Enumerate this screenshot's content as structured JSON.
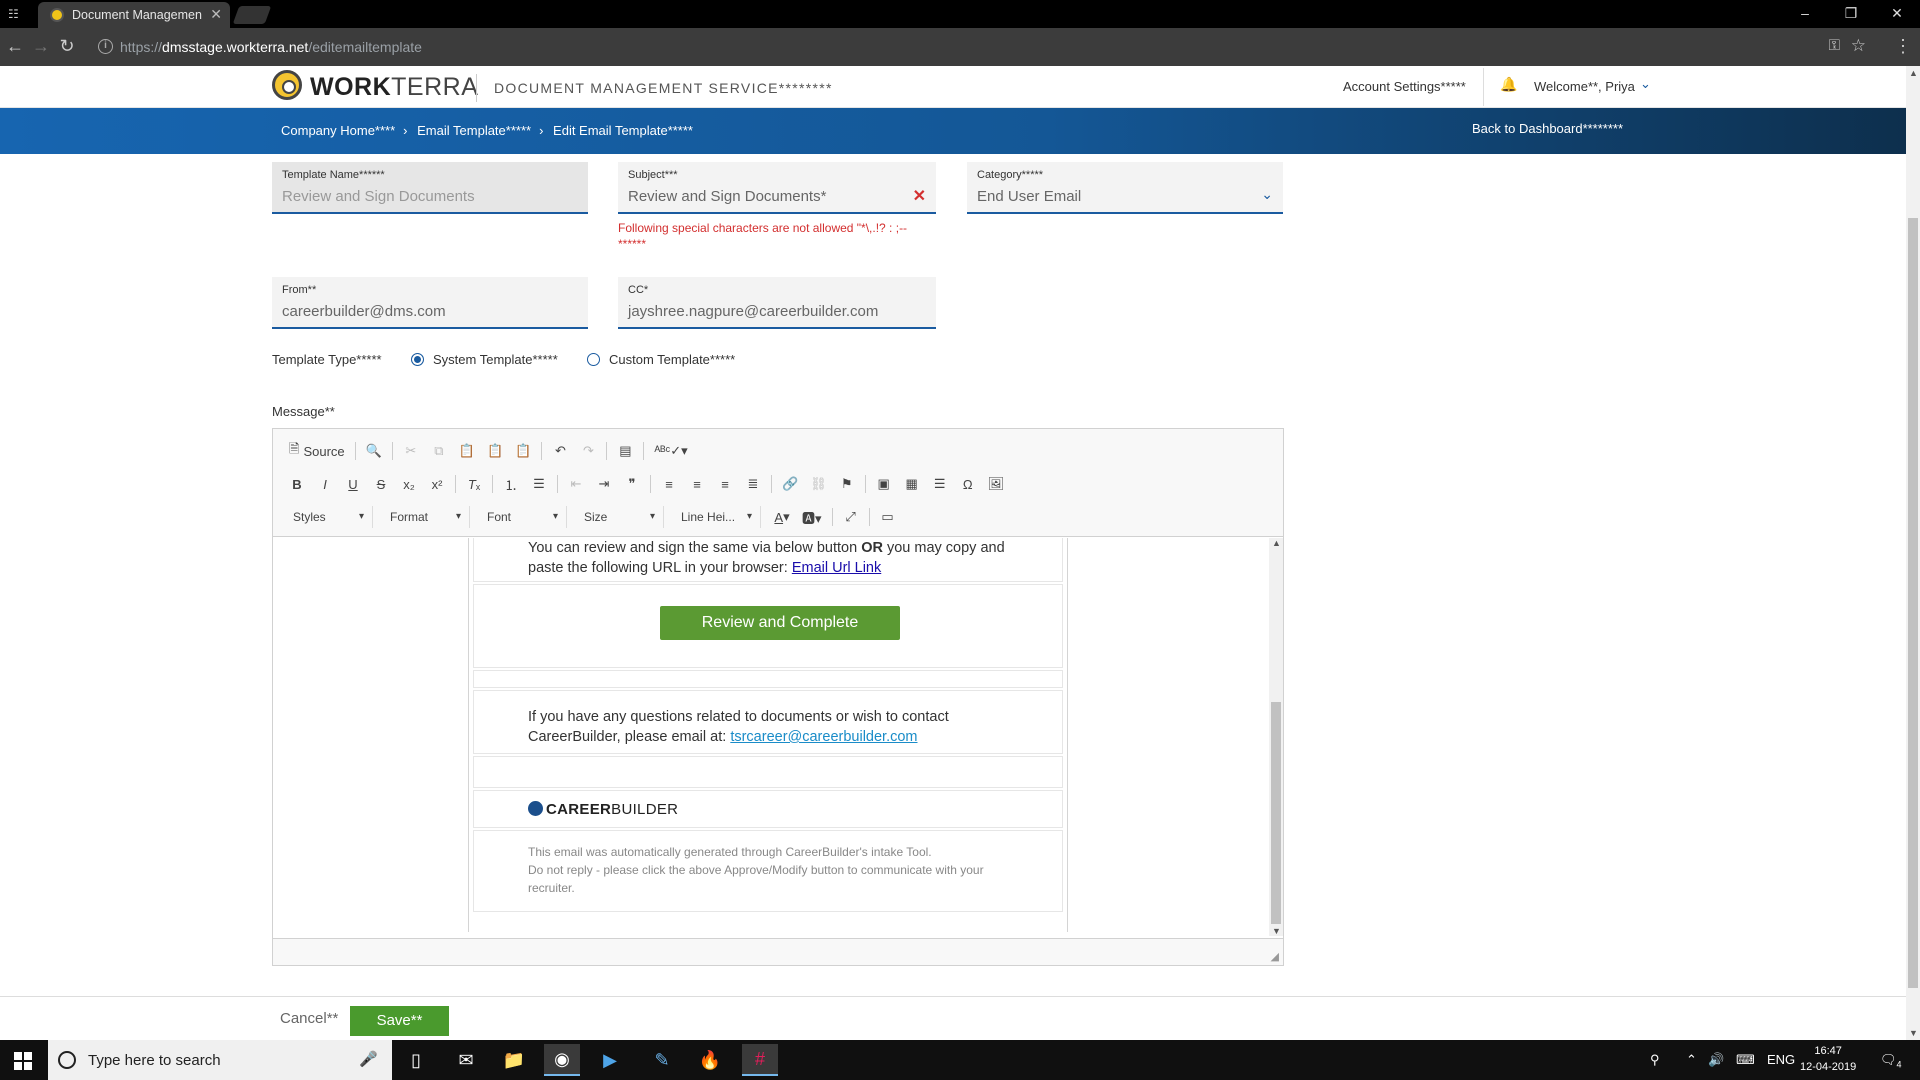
{
  "browser": {
    "tab_title": "Document Management",
    "url_prefix": "https://",
    "url_domain": "dmsstage.workterra.net",
    "url_path": "/editemailtemplate"
  },
  "header": {
    "brand_bold": "WORK",
    "brand_light": "TERRA",
    "app_name": "DOCUMENT MANAGEMENT SERVICE********",
    "account_settings": "Account Settings*****",
    "welcome": "Welcome**, Priya"
  },
  "breadcrumb": {
    "items": [
      "Company Home****",
      "Email Template*****",
      "Edit Email Template*****"
    ],
    "back": "Back to Dashboard********"
  },
  "form": {
    "template_name": {
      "label": "Template Name******",
      "value": "Review and Sign Documents"
    },
    "subject": {
      "label": "Subject***",
      "value": "Review and Sign Documents*",
      "error": "Following special characters are not allowed \"*\\,.!? : ;-- ******"
    },
    "category": {
      "label": "Category*****",
      "value": "End User Email"
    },
    "from": {
      "label": "From**",
      "value": "careerbuilder@dms.com"
    },
    "cc": {
      "label": "CC*",
      "value": "jayshree.nagpure@careerbuilder.com"
    },
    "template_type_label": "Template Type*****",
    "system_template": "System Template*****",
    "custom_template": "Custom Template*****",
    "selected_template_type": "System Template",
    "message_label": "Message**"
  },
  "editor": {
    "source_label": "Source",
    "styles": "Styles",
    "format": "Format",
    "font": "Font",
    "size": "Size",
    "line_height": "Line Hei..."
  },
  "email": {
    "p1_a": "You can review and sign the same via below button ",
    "p1_bold": "OR",
    "p1_b": " you may copy and",
    "p1_c": "paste the following URL in your browser: ",
    "p1_link": "Email Url Link",
    "button": "Review and Complete",
    "p2_a": "If you have any questions related to documents or wish to contact",
    "p2_b": "CareerBuilder, please email at: ",
    "p2_link": "tsrcareer@careerbuilder.com",
    "logo_bold": "CAREER",
    "logo_light": "BUILDER",
    "footer_1": "This email was automatically generated through CareerBuilder's intake Tool.",
    "footer_2": "Do not reply - please click the above Approve/Modify button to communicate with your",
    "footer_3": "recruiter."
  },
  "actions": {
    "cancel": "Cancel**",
    "save": "Save**"
  },
  "taskbar": {
    "search_placeholder": "Type here to search",
    "language": "ENG",
    "time": "16:47",
    "date": "12-04-2019",
    "notification_count": "4"
  },
  "colors": {
    "brand_blue": "#1a5ba0",
    "save_green": "#4a9a2d",
    "error_red": "#d32f2f",
    "cta_green": "#5b9a33"
  }
}
